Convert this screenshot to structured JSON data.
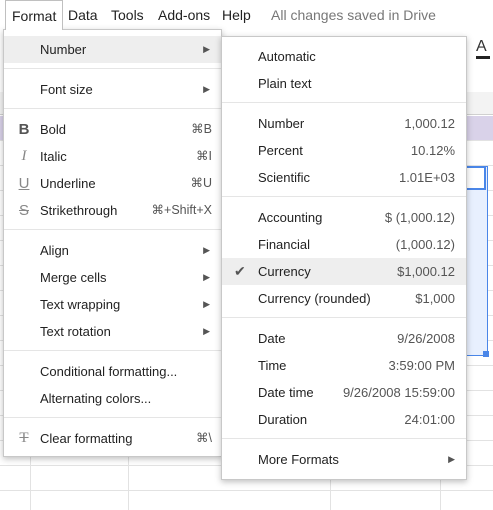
{
  "menubar": {
    "items": [
      "Format",
      "Data",
      "Tools",
      "Add-ons",
      "Help"
    ],
    "status": "All changes saved in Drive"
  },
  "toolbar": {
    "fragment_glyph": "A"
  },
  "format_menu": {
    "number": "Number",
    "font_size": "Font size",
    "bold": "Bold",
    "bold_sc": "⌘B",
    "italic": "Italic",
    "italic_sc": "⌘I",
    "underline": "Underline",
    "underline_sc": "⌘U",
    "strikethrough": "Strikethrough",
    "strikethrough_sc": "⌘+Shift+X",
    "align": "Align",
    "merge_cells": "Merge cells",
    "text_wrapping": "Text wrapping",
    "text_rotation": "Text rotation",
    "conditional": "Conditional formatting...",
    "alternating": "Alternating colors...",
    "clear": "Clear formatting",
    "clear_sc": "⌘\\"
  },
  "number_menu": {
    "automatic": "Automatic",
    "plain_text": "Plain text",
    "number": "Number",
    "number_val": "1,000.12",
    "percent": "Percent",
    "percent_val": "10.12%",
    "scientific": "Scientific",
    "scientific_val": "1.01E+03",
    "accounting": "Accounting",
    "accounting_val": "$ (1,000.12)",
    "financial": "Financial",
    "financial_val": "(1,000.12)",
    "currency": "Currency",
    "currency_val": "$1,000.12",
    "currency_rounded": "Currency (rounded)",
    "currency_rounded_val": "$1,000",
    "date": "Date",
    "date_val": "9/26/2008",
    "time": "Time",
    "time_val": "3:59:00 PM",
    "date_time": "Date time",
    "date_time_val": "9/26/2008 15:59:00",
    "duration": "Duration",
    "duration_val": "24:01:00",
    "more_formats": "More Formats"
  },
  "colors": {
    "selection": "#4a86e8",
    "band": "#d9d2e9",
    "hover": "#eeeeee"
  }
}
